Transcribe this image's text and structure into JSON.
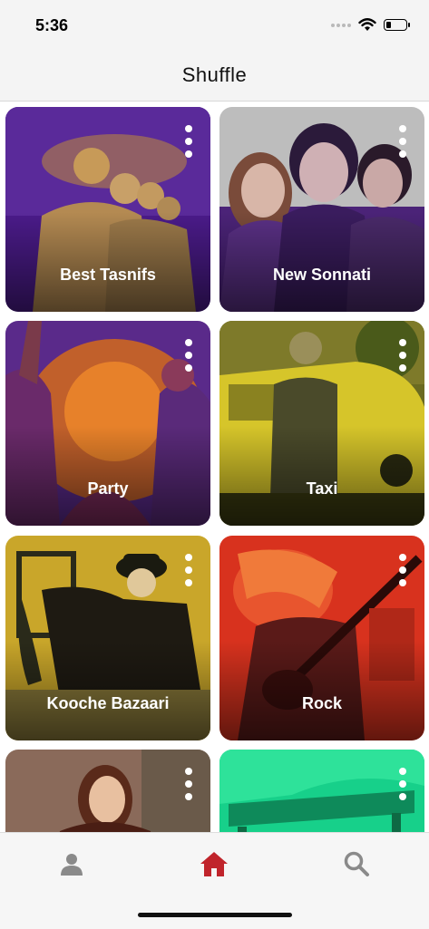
{
  "status_bar": {
    "time": "5:36"
  },
  "header": {
    "title": "Shuffle"
  },
  "playlists": [
    {
      "label": "Best Tasnifs",
      "more_icon": "more-vertical-icon"
    },
    {
      "label": "New Sonnati",
      "more_icon": "more-vertical-icon"
    },
    {
      "label": "Party",
      "more_icon": "more-vertical-icon"
    },
    {
      "label": "Taxi",
      "more_icon": "more-vertical-icon"
    },
    {
      "label": "Kooche Bazaari",
      "more_icon": "more-vertical-icon"
    },
    {
      "label": "Rock",
      "more_icon": "more-vertical-icon"
    },
    {
      "label": "",
      "more_icon": "more-vertical-icon"
    },
    {
      "label": "",
      "more_icon": "more-vertical-icon"
    }
  ],
  "tab_bar": {
    "tabs": [
      {
        "icon": "profile-icon",
        "active": false
      },
      {
        "icon": "home-icon",
        "active": true
      },
      {
        "icon": "search-icon",
        "active": false
      }
    ],
    "active_color": "#c0242b",
    "inactive_color": "#8a8a8a"
  }
}
